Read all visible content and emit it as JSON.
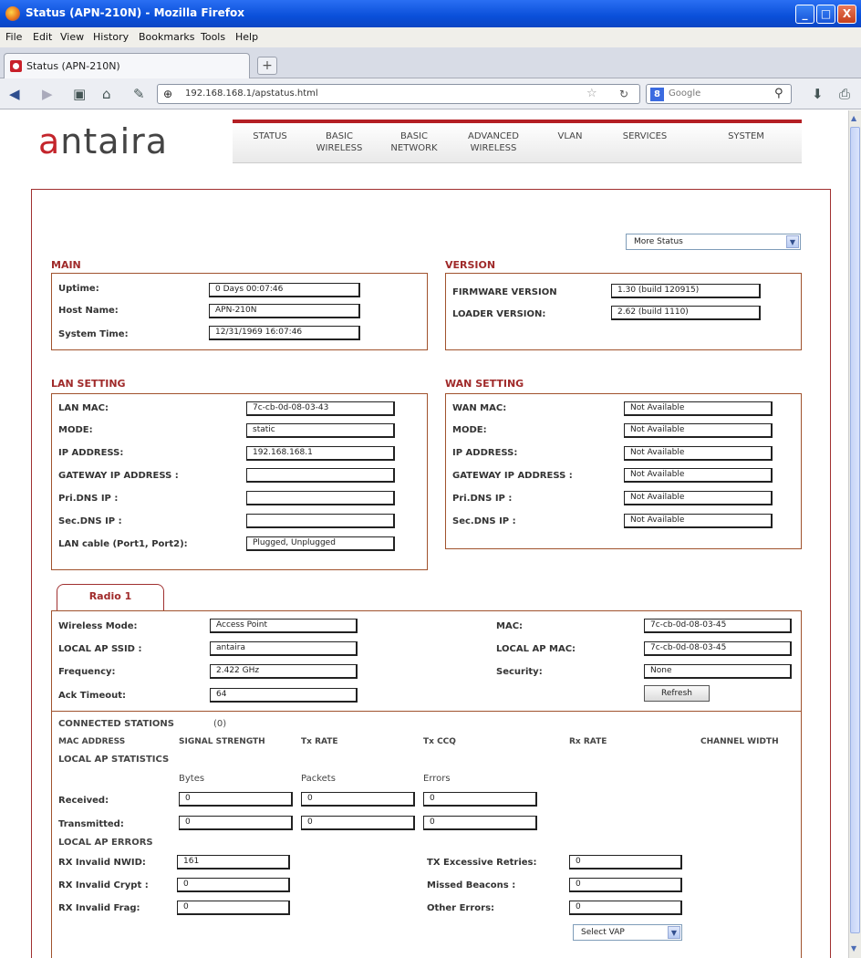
{
  "window": {
    "title": "Status (APN-210N) - Mozilla Firefox",
    "min": "_",
    "max": "□",
    "close": "X"
  },
  "menu": [
    "File",
    "Edit",
    "View",
    "History",
    "Bookmarks",
    "Tools",
    "Help"
  ],
  "tab": {
    "label": "Status (APN-210N)",
    "new_tab": "+"
  },
  "nav": {
    "url": "192.168.168.1/apstatus.html",
    "search_placeholder": "Google"
  },
  "logo": {
    "first": "a",
    "rest": "ntaira"
  },
  "topnav": [
    {
      "l1": "STATUS",
      "l2": ""
    },
    {
      "l1": "BASIC",
      "l2": "WIRELESS"
    },
    {
      "l1": "BASIC",
      "l2": "NETWORK"
    },
    {
      "l1": "ADVANCED",
      "l2": "WIRELESS"
    },
    {
      "l1": "VLAN",
      "l2": ""
    },
    {
      "l1": "SERVICES",
      "l2": ""
    },
    {
      "l1": "SYSTEM",
      "l2": ""
    }
  ],
  "more_status": "More Status",
  "main": {
    "title": "MAIN",
    "uptime_label": "Uptime:",
    "uptime": "0 Days 00:07:46",
    "host_label": "Host Name:",
    "host": "APN-210N",
    "time_label": "System Time:",
    "time": "12/31/1969 16:07:46"
  },
  "version": {
    "title": "VERSION",
    "fw_label": "FIRMWARE VERSION",
    "fw": "1.30 (build 120915)",
    "loader_label": "LOADER VERSION:",
    "loader": "2.62 (build 1110)"
  },
  "lan": {
    "title": "LAN SETTING",
    "mac_label": "LAN MAC:",
    "mac": "7c-cb-0d-08-03-43",
    "mode_label": "MODE:",
    "mode": "static",
    "ip_label": "IP ADDRESS:",
    "ip": "192.168.168.1",
    "gw_label": "GATEWAY IP ADDRESS :",
    "gw": "",
    "pdns_label": "Pri.DNS IP :",
    "pdns": "",
    "sdns_label": "Sec.DNS IP :",
    "sdns": "",
    "cable_label": "LAN cable (Port1, Port2):",
    "cable": "Plugged, Unplugged"
  },
  "wan": {
    "title": "WAN SETTING",
    "mac_label": "WAN MAC:",
    "mac": "Not Available",
    "mode_label": "MODE:",
    "mode": "Not Available",
    "ip_label": "IP ADDRESS:",
    "ip": "Not Available",
    "gw_label": "GATEWAY IP ADDRESS :",
    "gw": "Not Available",
    "pdns_label": "Pri.DNS IP :",
    "pdns": "Not Available",
    "sdns_label": "Sec.DNS IP :",
    "sdns": "Not Available"
  },
  "radio": {
    "tab": "Radio 1",
    "mode_label": "Wireless Mode:",
    "mode": "Access Point",
    "ssid_label": "LOCAL AP SSID :",
    "ssid": "antaira",
    "freq_label": "Frequency:",
    "freq": "2.422 GHz",
    "ack_label": "Ack Timeout:",
    "ack": "64",
    "mac_label": "MAC:",
    "mac": "7c-cb-0d-08-03-45",
    "apmac_label": "LOCAL AP MAC:",
    "apmac": "7c-cb-0d-08-03-45",
    "sec_label": "Security:",
    "sec": "None",
    "refresh": "Refresh"
  },
  "stations": {
    "title": "CONNECTED STATIONS",
    "count": "(0)",
    "cols": [
      "MAC ADDRESS",
      "SIGNAL STRENGTH",
      "Tx RATE",
      "Tx CCQ",
      "Rx RATE",
      "CHANNEL WIDTH"
    ]
  },
  "stats": {
    "title": "LOCAL AP STATISTICS",
    "h_bytes": "Bytes",
    "h_packets": "Packets",
    "h_errors": "Errors",
    "rx_label": "Received:",
    "rx_bytes": "0",
    "rx_packets": "0",
    "rx_errors": "0",
    "tx_label": "Transmitted:",
    "tx_bytes": "0",
    "tx_packets": "0",
    "tx_errors": "0"
  },
  "errors": {
    "title": "LOCAL AP ERRORS",
    "nwid_label": "RX Invalid NWID:",
    "nwid": "161",
    "crypt_label": "RX Invalid Crypt :",
    "crypt": "0",
    "frag_label": "RX Invalid Frag:",
    "frag": "0",
    "retries_label": "TX Excessive Retries:",
    "retries": "0",
    "beacons_label": "Missed Beacons :",
    "beacons": "0",
    "other_label": "Other Errors:",
    "other": "0"
  },
  "select_vap": "Select VAP"
}
